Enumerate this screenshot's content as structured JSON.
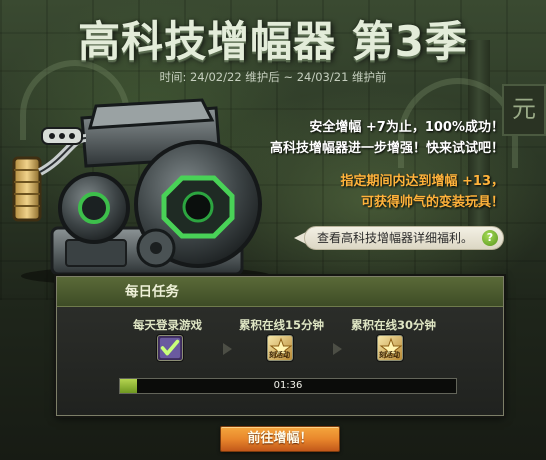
{
  "event": {
    "title": "高科技增幅器 第3季",
    "period": "时间: 24/02/22 维护后 ~ 24/03/21 维护前"
  },
  "promo": {
    "line1": "安全增幅 +7为止，100%成功！",
    "line2": "高科技增幅器进一步增强！快来试试吧！",
    "line3": "指定期间内达到增幅 +13，",
    "line4": "可获得帅气的变装玩具！"
  },
  "detail_link": {
    "label": "查看高科技增幅器详细福利。",
    "help_glyph": "?"
  },
  "daily_tasks": {
    "title": "每日任务",
    "tasks": [
      {
        "label": "每天登录游戏",
        "state": "completed",
        "icon": "checkmark-icon"
      },
      {
        "label": "累积在线15分钟",
        "state": "pending",
        "icon": "reward-box-icon"
      },
      {
        "label": "累积在线30分钟",
        "state": "pending",
        "icon": "reward-box-icon"
      }
    ],
    "reward_icon_text": "刻活动",
    "progress": {
      "fraction": 0.05,
      "time": "01:36"
    }
  },
  "button": {
    "label": "前往增幅！"
  },
  "colors": {
    "accent_orange": "#ffb33b",
    "button_orange": "#e9872c",
    "progress_green": "#9cc13a",
    "header_green": "#4b5a2e"
  }
}
